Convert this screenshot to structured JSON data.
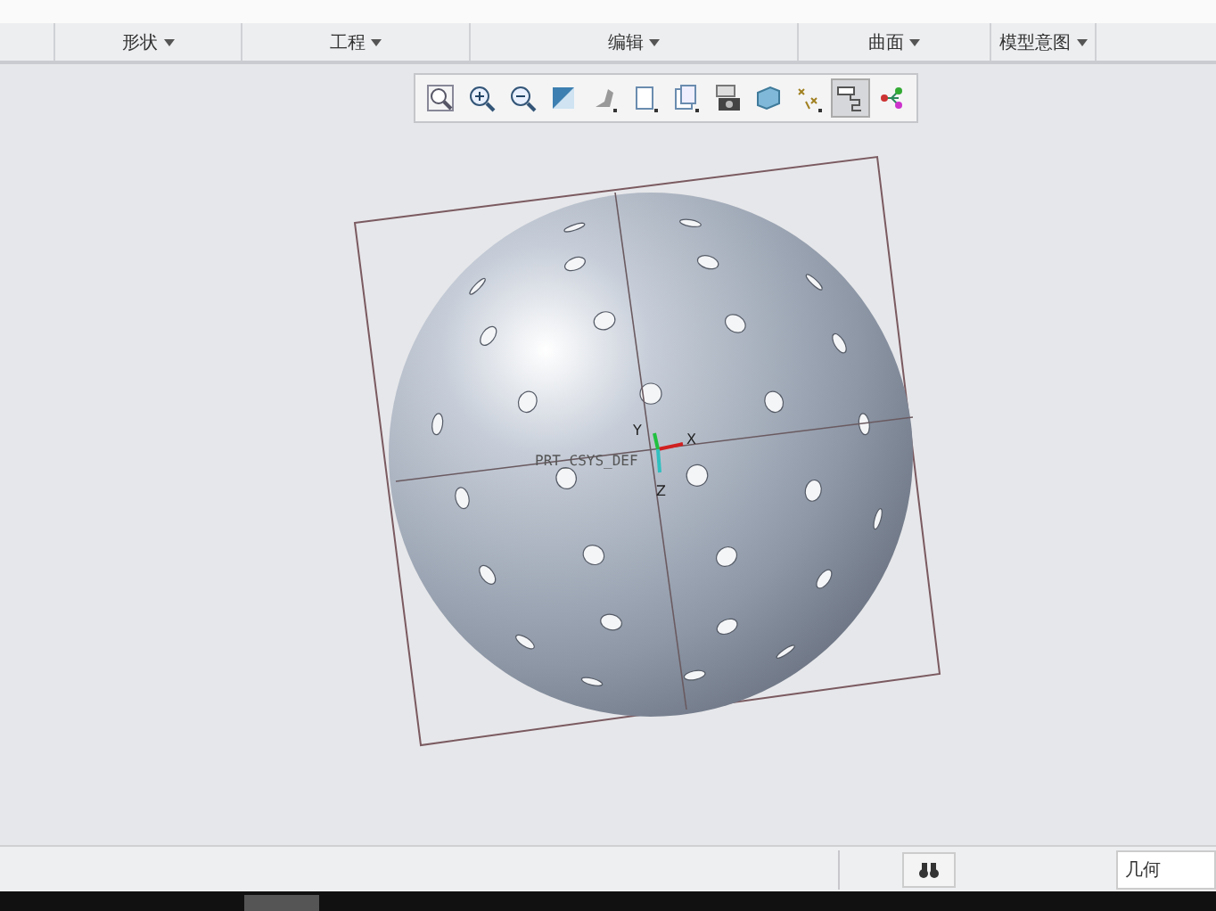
{
  "ribbon": {
    "groups": [
      {
        "label": "形状"
      },
      {
        "label": "工程"
      },
      {
        "label": "编辑"
      },
      {
        "label": "曲面"
      },
      {
        "label": "模型意图"
      }
    ]
  },
  "view_toolbar": {
    "tools": [
      {
        "kind": "zoom-fit",
        "selected": false
      },
      {
        "kind": "zoom-in",
        "selected": false
      },
      {
        "kind": "zoom-out",
        "selected": false
      },
      {
        "kind": "repaint",
        "selected": false
      },
      {
        "kind": "shade",
        "selected": false
      },
      {
        "kind": "orient",
        "selected": false
      },
      {
        "kind": "views",
        "selected": false
      },
      {
        "kind": "camera",
        "selected": false
      },
      {
        "kind": "box",
        "selected": false
      },
      {
        "kind": "points",
        "selected": false
      },
      {
        "kind": "planes",
        "selected": true
      },
      {
        "kind": "nodes",
        "selected": false
      }
    ]
  },
  "canvas": {
    "csys_label": "PRT_CSYS_DEF",
    "axes": [
      "X",
      "Y",
      "Z"
    ]
  },
  "status_bar": {
    "filter_value": "几何"
  }
}
